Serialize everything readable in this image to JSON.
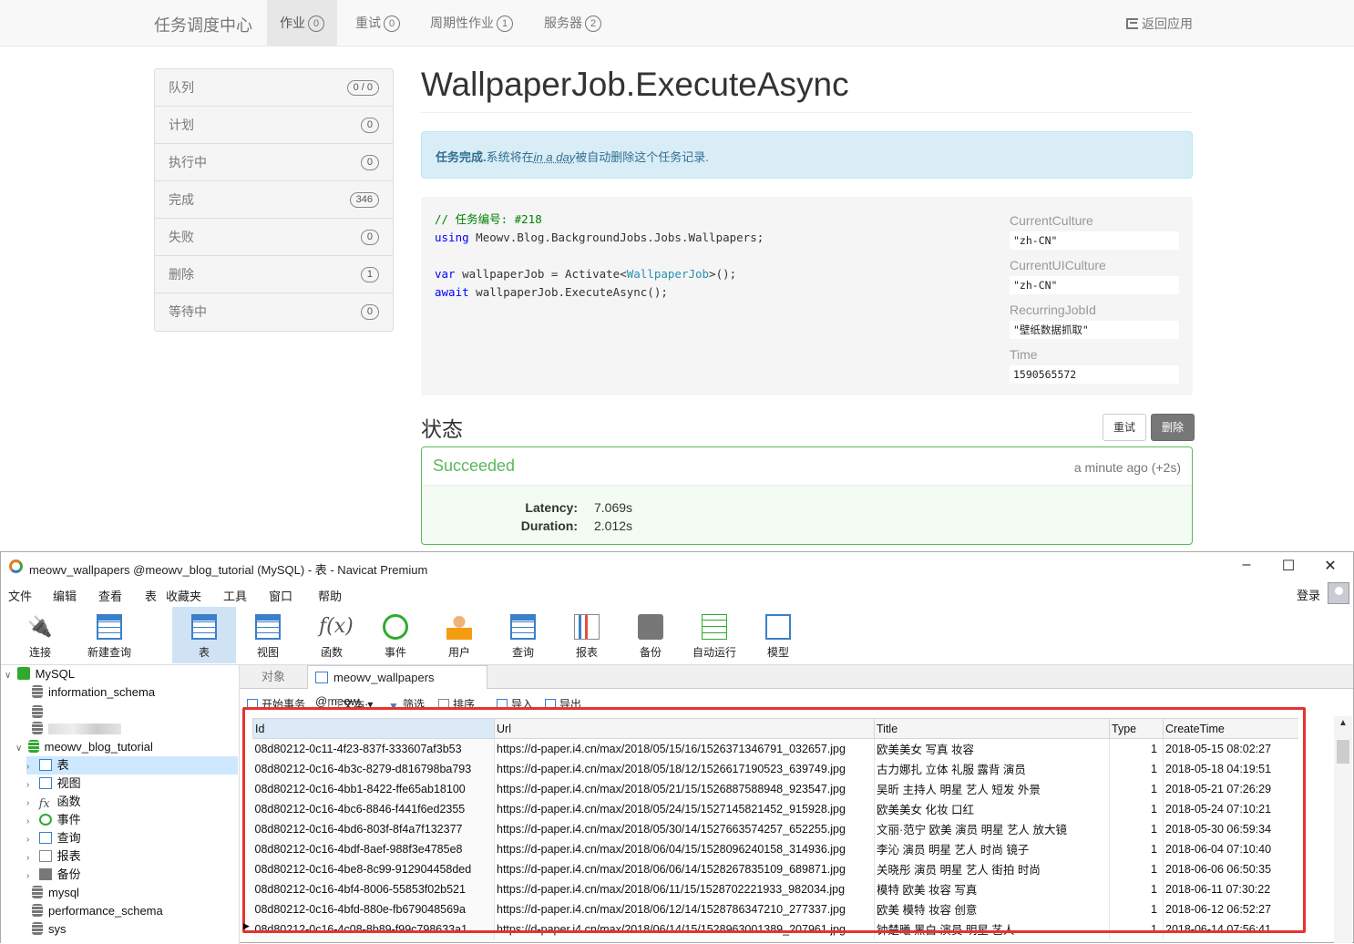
{
  "nav": {
    "brand": "任务调度中心",
    "items": [
      {
        "label": "作业",
        "count": "0"
      },
      {
        "label": "重试",
        "count": "0"
      },
      {
        "label": "周期性作业",
        "count": "1"
      },
      {
        "label": "服务器",
        "count": "2"
      }
    ],
    "back": "返回应用"
  },
  "sidebar": [
    {
      "label": "队列",
      "count": "0 / 0"
    },
    {
      "label": "计划",
      "count": "0"
    },
    {
      "label": "执行中",
      "count": "0"
    },
    {
      "label": "完成",
      "count": "346"
    },
    {
      "label": "失败",
      "count": "0"
    },
    {
      "label": "删除",
      "count": "1"
    },
    {
      "label": "等待中",
      "count": "0"
    }
  ],
  "job": {
    "title": "WallpaperJob.ExecuteAsync",
    "alert_bold": "任务完成.",
    "alert_pre": "系统将在",
    "alert_em": "in a day",
    "alert_post": "被自动删除这个任务记录.",
    "code": {
      "l1": "// 任务编号: #218",
      "l2_kw": "using",
      "l2_rest": " Meowv.Blog.BackgroundJobs.Jobs.Wallpapers;",
      "l4_kw": "var",
      "l4_a": " wallpaperJob = Activate<",
      "l4_type": "WallpaperJob",
      "l4_b": ">();",
      "l5_kw": "await",
      "l5_rest": " wallpaperJob.ExecuteAsync();"
    },
    "params": [
      {
        "label": "CurrentCulture",
        "value": "\"zh-CN\""
      },
      {
        "label": "CurrentUICulture",
        "value": "\"zh-CN\""
      },
      {
        "label": "RecurringJobId",
        "value": "\"壁纸数据抓取\""
      },
      {
        "label": "Time",
        "value": "1590565572"
      }
    ]
  },
  "state": {
    "title": "状态",
    "retry": "重试",
    "delete": "删除",
    "name": "Succeeded",
    "time": "a minute ago (+2s)",
    "latency_label": "Latency:",
    "latency": "7.069s",
    "duration_label": "Duration:",
    "duration": "2.012s"
  },
  "navicat": {
    "title": "meowv_wallpapers @meowv_blog_tutorial (MySQL) - 表 - Navicat Premium",
    "menu": [
      "文件",
      "编辑",
      "查看",
      "表",
      "收藏夹",
      "工具",
      "窗口",
      "帮助"
    ],
    "login": "登录",
    "toolbar": [
      "连接",
      "新建查询",
      "表",
      "视图",
      "函数",
      "事件",
      "用户",
      "查询",
      "报表",
      "备份",
      "自动运行",
      "模型"
    ],
    "tree": {
      "root": "MySQL",
      "information_schema": "information_schema",
      "blog_db": "meowv_blog_tutorial",
      "children": [
        "表",
        "视图",
        "函数",
        "事件",
        "查询",
        "报表",
        "备份"
      ],
      "mysql": "mysql",
      "performance_schema": "performance_schema",
      "sys": "sys"
    },
    "tab_objects": "对象",
    "tab_table": "meowv_wallpapers @meow...",
    "subtoolbar": [
      "开始事务",
      "文本",
      "筛选",
      "排序",
      "导入",
      "导出"
    ],
    "columns": [
      "Id",
      "Url",
      "Title",
      "Type",
      "CreateTime"
    ],
    "rows": [
      [
        "08d80212-0c11-4f23-837f-333607af3b53",
        "https://d-paper.i4.cn/max/2018/05/15/16/1526371346791_032657.jpg",
        "欧美美女 写真 妆容",
        "1",
        "2018-05-15 08:02:27"
      ],
      [
        "08d80212-0c16-4b3c-8279-d816798ba793",
        "https://d-paper.i4.cn/max/2018/05/18/12/1526617190523_639749.jpg",
        "古力娜扎 立体 礼服 露背 演员",
        "1",
        "2018-05-18 04:19:51"
      ],
      [
        "08d80212-0c16-4bb1-8422-ffe65ab18100",
        "https://d-paper.i4.cn/max/2018/05/21/15/1526887588948_923547.jpg",
        "吴昕 主持人 明星 艺人 短发 外景",
        "1",
        "2018-05-21 07:26:29"
      ],
      [
        "08d80212-0c16-4bc6-8846-f441f6ed2355",
        "https://d-paper.i4.cn/max/2018/05/24/15/1527145821452_915928.jpg",
        "欧美美女 化妆 口红",
        "1",
        "2018-05-24 07:10:21"
      ],
      [
        "08d80212-0c16-4bd6-803f-8f4a7f132377",
        "https://d-paper.i4.cn/max/2018/05/30/14/1527663574257_652255.jpg",
        "文丽·范宁 欧美 演员 明星 艺人 放大镜",
        "1",
        "2018-05-30 06:59:34"
      ],
      [
        "08d80212-0c16-4bdf-8aef-988f3e4785e8",
        "https://d-paper.i4.cn/max/2018/06/04/15/1528096240158_314936.jpg",
        "李沁 演员 明星 艺人 时尚 镜子",
        "1",
        "2018-06-04 07:10:40"
      ],
      [
        "08d80212-0c16-4be8-8c99-912904458ded",
        "https://d-paper.i4.cn/max/2018/06/06/14/1528267835109_689871.jpg",
        "关晓彤 演员 明星 艺人 街拍 时尚",
        "1",
        "2018-06-06 06:50:35"
      ],
      [
        "08d80212-0c16-4bf4-8006-55853f02b521",
        "https://d-paper.i4.cn/max/2018/06/11/15/1528702221933_982034.jpg",
        "模特 欧美 妆容 写真",
        "1",
        "2018-06-11 07:30:22"
      ],
      [
        "08d80212-0c16-4bfd-880e-fb679048569a",
        "https://d-paper.i4.cn/max/2018/06/12/14/1528786347210_277337.jpg",
        "欧美 模特 妆容 创意",
        "1",
        "2018-06-12 06:52:27"
      ],
      [
        "08d80212-0c16-4c08-8b89-f99c798633a1",
        "https://d-paper.i4.cn/max/2018/06/14/15/1528963001389_207961.jpg",
        "钟楚曦 黑白 演员 明星 艺人",
        "1",
        "2018-06-14 07:56:41"
      ]
    ]
  }
}
